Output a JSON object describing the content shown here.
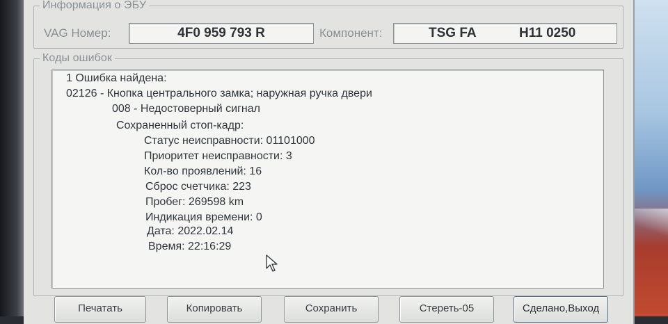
{
  "ecu_info": {
    "title": "Информация о ЭБУ",
    "vag_label": "VAG Номер:",
    "vag_value": "4F0 959 793 R",
    "component_label": "Компонент:",
    "component_name": "TSG FA",
    "component_version": "H11 0250"
  },
  "fault_codes": {
    "title": "Коды ошибок",
    "lines": [
      "1 Ошибка найдена:",
      "02126 - Кнопка центрального замка; наружная ручка двери",
      "008 - Недостоверный сигнал",
      "Сохраненный стоп-кадр:",
      "Статус неисправности: 01101000",
      "Приоритет неисправности: 3",
      "Кол-во проявлений: 16",
      "Сброс счетчика: 223",
      "Пробег: 269598 km",
      "Индикация времени: 0",
      "Дата: 2022.02.14",
      "Время: 22:16:29"
    ]
  },
  "buttons": {
    "print": "Печатать",
    "copy": "Копировать",
    "save": "Сохранить",
    "clear": "Стереть-05",
    "done": "Сделано,Выход"
  },
  "icons": {
    "cursor": "mouse-pointer-icon"
  },
  "colors": {
    "window_bg": "#e3e4e1",
    "text": "#30343a",
    "label": "#8a8e94"
  }
}
